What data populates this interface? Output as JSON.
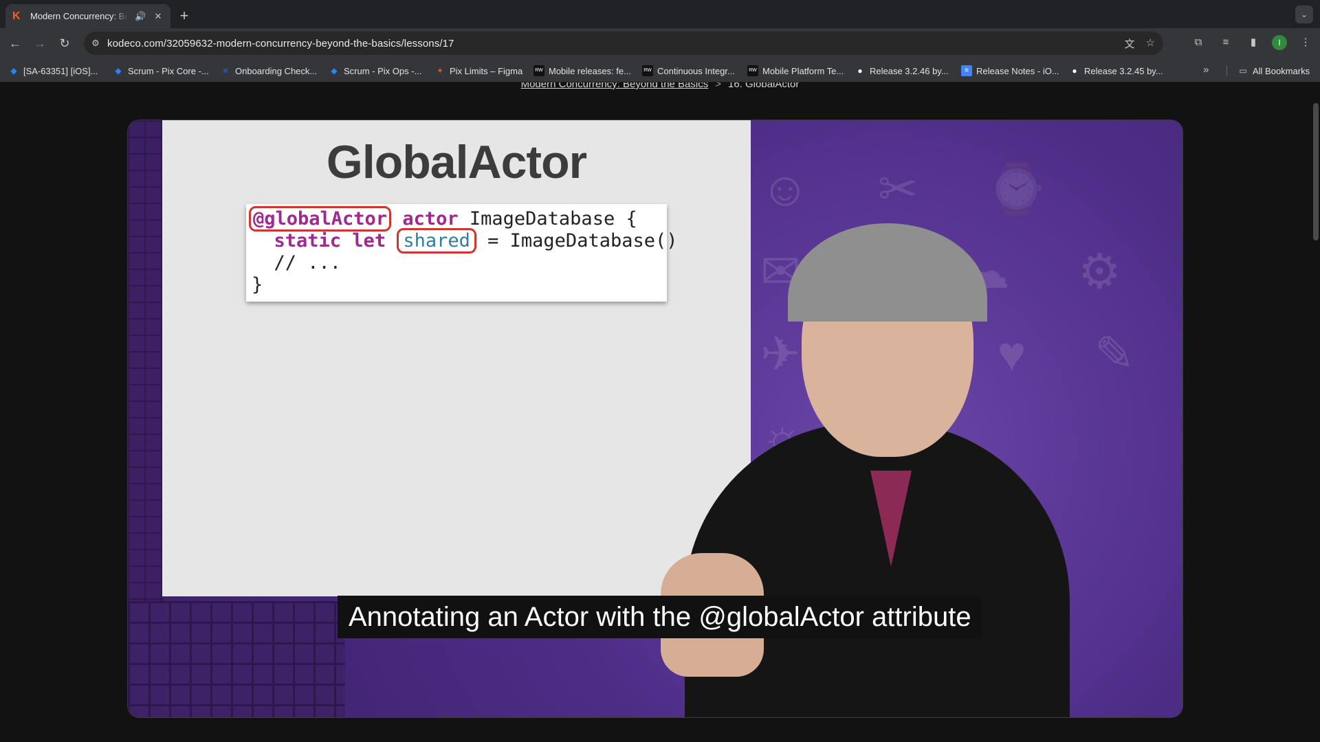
{
  "browser": {
    "tab": {
      "title": "Modern Concurrency: Beyond the Basics",
      "favicon": "K"
    },
    "url": "kodeco.com/32059632-modern-concurrency-beyond-the-basics/lessons/17",
    "profile_initial": "I",
    "bookmarks": [
      {
        "label": "[SA-63351] [iOS]...",
        "icon": "jira-icon"
      },
      {
        "label": "Scrum - Pix Core -...",
        "icon": "jira-icon"
      },
      {
        "label": "Onboarding Check...",
        "icon": "confluence-icon"
      },
      {
        "label": "Scrum - Pix Ops -...",
        "icon": "jira-icon"
      },
      {
        "label": "Pix Limits – Figma",
        "icon": "figma-icon"
      },
      {
        "label": "Mobile releases: fe...",
        "icon": "rwt-icon"
      },
      {
        "label": "Continuous Integr...",
        "icon": "rwt-icon"
      },
      {
        "label": "Mobile Platform Te...",
        "icon": "rwt-icon"
      },
      {
        "label": "Release 3.2.46 by...",
        "icon": "github-icon"
      },
      {
        "label": "Release Notes - iO...",
        "icon": "docs-icon"
      },
      {
        "label": "Release 3.2.45 by...",
        "icon": "github-icon"
      }
    ],
    "all_bookmarks_label": "All Bookmarks"
  },
  "breadcrumb": {
    "course": "Modern Concurrency: Beyond the Basics",
    "separator": ">",
    "lesson": "16. GlobalActor"
  },
  "slide": {
    "title": "GlobalActor",
    "code": {
      "attr": "@globalActor",
      "line1_kw": "actor",
      "line1_rest": " ImageDatabase {",
      "line2_kw": "static let",
      "line2_shared": "shared",
      "line2_rest": " = ImageDatabase()",
      "line3": "  // ...",
      "line4": "}"
    }
  },
  "caption": "Annotating an Actor with the @globalActor attribute"
}
